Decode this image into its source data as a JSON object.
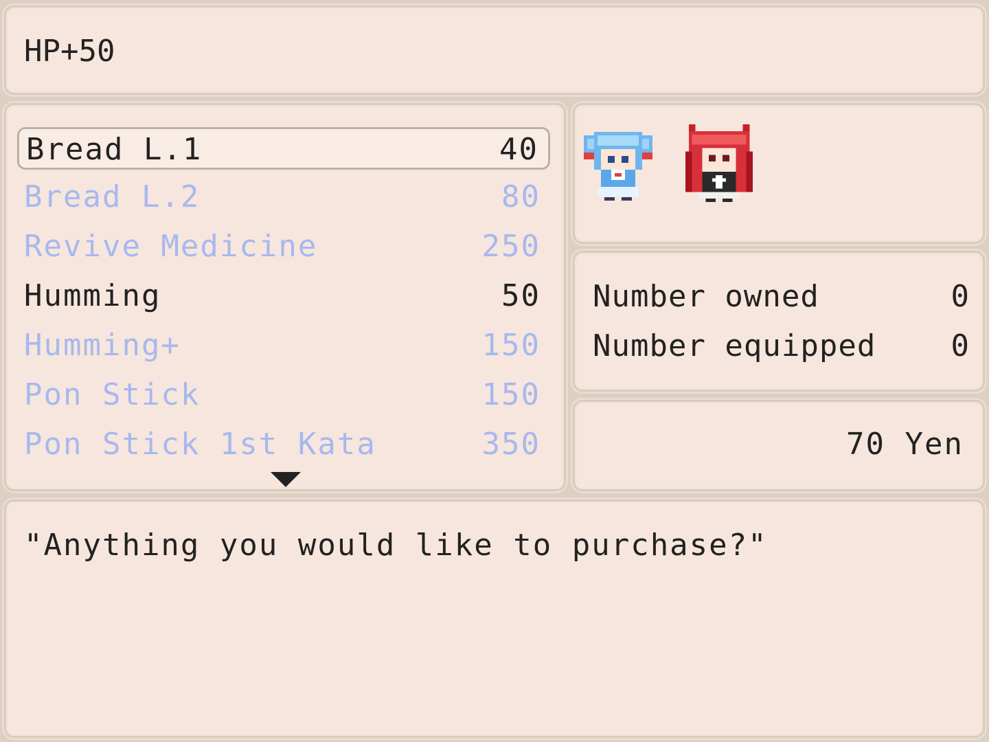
{
  "help": {
    "text": "HP+50"
  },
  "shop_items": [
    {
      "name": "Bread L.1",
      "price": "40",
      "enabled": true,
      "selected": true
    },
    {
      "name": "Bread L.2",
      "price": "80",
      "enabled": false,
      "selected": false
    },
    {
      "name": "Revive Medicine",
      "price": "250",
      "enabled": false,
      "selected": false
    },
    {
      "name": "Humming",
      "price": "50",
      "enabled": true,
      "selected": false
    },
    {
      "name": "Humming+",
      "price": "150",
      "enabled": false,
      "selected": false
    },
    {
      "name": "Pon Stick",
      "price": "150",
      "enabled": false,
      "selected": false
    },
    {
      "name": "Pon Stick 1st Kata",
      "price": "350",
      "enabled": false,
      "selected": false
    }
  ],
  "party_sprites": [
    "blue-haired-girl-sprite",
    "red-hooded-girl-sprite"
  ],
  "counts": {
    "owned_label": "Number owned",
    "owned_value": "0",
    "equipped_label": "Number equipped",
    "equipped_value": "0"
  },
  "gold": {
    "amount": "70",
    "unit": "Yen",
    "display": "70 Yen"
  },
  "message": {
    "text": "\"Anything you would like to purchase?\""
  },
  "colors": {
    "panel_bg": "#f6e6dd",
    "panel_border": "#d9cbbd",
    "text": "#222222",
    "disabled_text": "#a7b8ee"
  }
}
